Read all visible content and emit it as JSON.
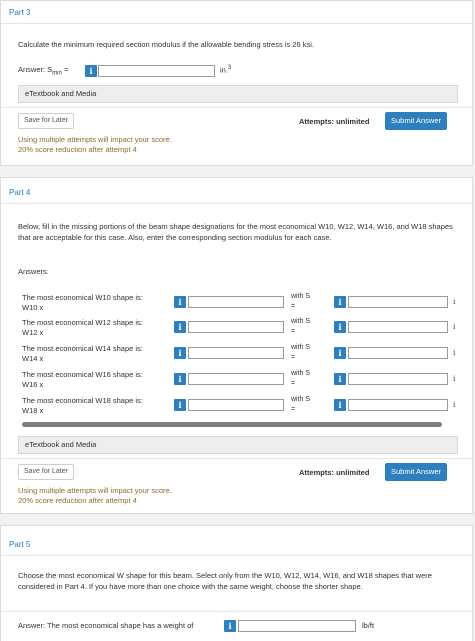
{
  "part3": {
    "title": "Part 3",
    "prompt": "Calculate the minimum required section modulus if the allowable bending stress is 26 ksi.",
    "answer_label": "Answer: S",
    "answer_sub": "min",
    "answer_eq": " =",
    "input_value": "",
    "unit": "in.",
    "unit_sup": "3",
    "etextbook": "eTextbook and Media",
    "save": "Save for Later",
    "attempts": "Attempts: unlimited",
    "submit": "Submit Answer",
    "warn1": "Using multiple attempts will impact your score.",
    "warn2": "20% score reduction after attempt 4"
  },
  "part4": {
    "title": "Part 4",
    "prompt": "Below, fill in the missing portions of the beam shape designations for the most economical W10, W12, W14, W16, and W18 shapes that are acceptable for this case. Also, enter the corresponding section modulus for each case.",
    "answers_label": "Answers:",
    "rows": [
      {
        "line1": "The most economical W10 shape is:",
        "line2": "W10 x",
        "withs1": "with S",
        "withs2": "=",
        "trail": "i"
      },
      {
        "line1": "The most economical W12 shape is:",
        "line2": "W12 x",
        "withs1": "with S",
        "withs2": "=",
        "trail": "i"
      },
      {
        "line1": "The most economical W14 shape is:",
        "line2": "W14 x",
        "withs1": "with S",
        "withs2": "=",
        "trail": "i"
      },
      {
        "line1": "The most economical W16 shape is:",
        "line2": "W16 x",
        "withs1": "with S",
        "withs2": "=",
        "trail": "i"
      },
      {
        "line1": "The most economical W18 shape is:",
        "line2": "W18 x",
        "withs1": "with S",
        "withs2": "=",
        "trail": "i"
      }
    ],
    "etextbook": "eTextbook and Media",
    "save": "Save for Later",
    "attempts": "Attempts: unlimited",
    "submit": "Submit Answer",
    "warn1": "Using multiple attempts will impact your score.",
    "warn2": "20% score reduction after attempt 4"
  },
  "part5": {
    "title": "Part 5",
    "prompt": "Choose the most economical W shape for this beam. Select only from the W10, W12, W14, W16, and W18 shapes that were considered in Part 4. If you have more than one choice with the same weight, choose the shorter shape.",
    "answer_label": "Answer: The most economical shape has a weight of",
    "unit": "lb/ft"
  },
  "info_glyph": "i",
  "colors": {
    "accent": "#2d7fbd",
    "warning": "#8a6d2b",
    "title": "#2d7fbd"
  }
}
